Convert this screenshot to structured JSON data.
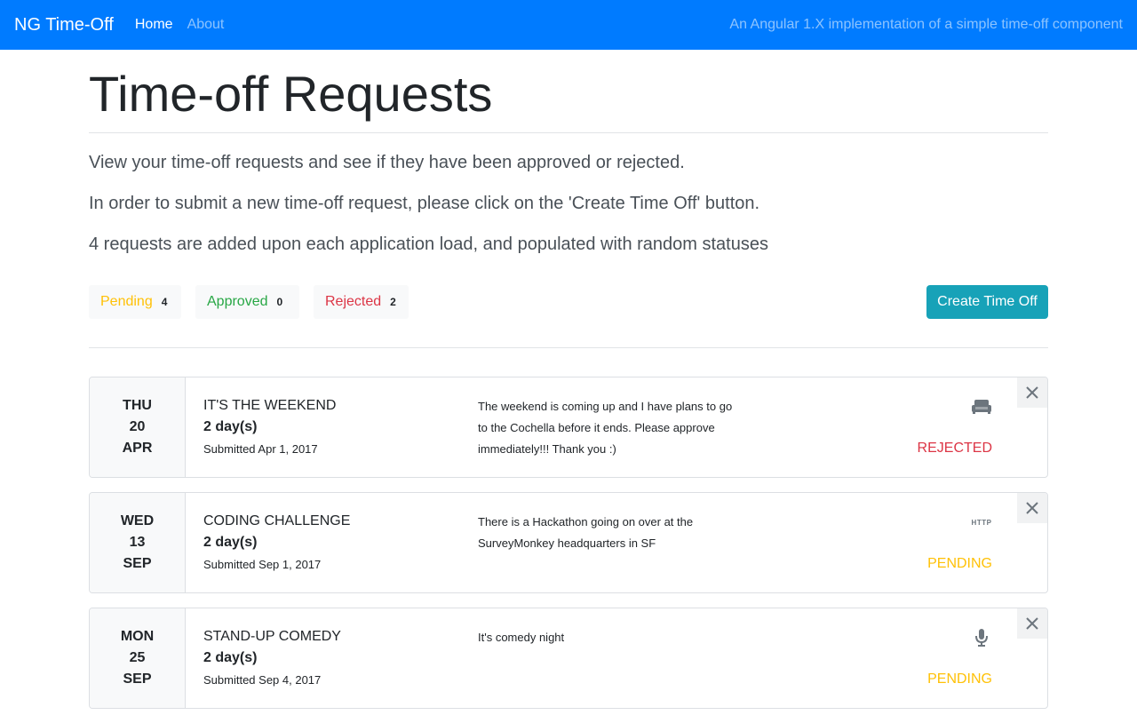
{
  "nav": {
    "brand": "NG Time-Off",
    "links": [
      "Home",
      "About"
    ],
    "tagline": "An Angular 1.X implementation of a simple time-off component"
  },
  "page": {
    "title": "Time-off Requests",
    "intro": [
      "View your time-off requests and see if they have been approved or rejected.",
      "In order to submit a new time-off request, please click on the 'Create Time Off' button.",
      "4 requests are added upon each application load, and populated with random statuses"
    ]
  },
  "filters": [
    {
      "label": "Pending",
      "count": "4",
      "color": "#ffc107"
    },
    {
      "label": "Approved",
      "count": "0",
      "color": "#28a745"
    },
    {
      "label": "Rejected",
      "count": "2",
      "color": "#dc3545"
    }
  ],
  "create_button": "Create Time Off",
  "requests": [
    {
      "weekday": "THU",
      "day": "20",
      "month": "APR",
      "title": "IT'S THE WEEKEND",
      "duration": "2 day(s)",
      "submitted": "Submitted Apr 1, 2017",
      "description": "The weekend is coming up and I have plans to go to the Cochella before it ends. Please approve immediately!!! Thank you :)",
      "icon": "couch-icon",
      "status": "REJECTED"
    },
    {
      "weekday": "WED",
      "day": "13",
      "month": "SEP",
      "title": "CODING CHALLENGE",
      "duration": "2 day(s)",
      "submitted": "Submitted Sep 1, 2017",
      "description": "There is a Hackathon going on over at the SurveyMonkey headquarters in SF",
      "icon": "http-icon",
      "icon_text": "HTTP",
      "status": "PENDING"
    },
    {
      "weekday": "MON",
      "day": "25",
      "month": "SEP",
      "title": "STAND-UP COMEDY",
      "duration": "2 day(s)",
      "submitted": "Submitted Sep 4, 2017",
      "description": "It's comedy night",
      "icon": "microphone-icon",
      "status": "PENDING"
    }
  ],
  "colors": {
    "primary": "#007bff",
    "info": "#17a2b8",
    "pending": "#ffc107",
    "approved": "#28a745",
    "rejected": "#dc3545"
  }
}
